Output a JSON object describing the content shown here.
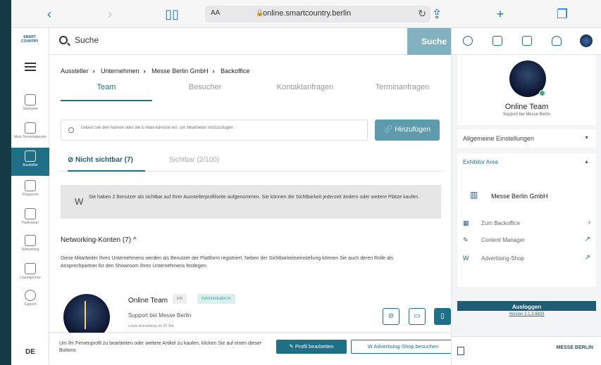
{
  "browser": {
    "text_size": "AA",
    "url": "online.smartcountry.berlin"
  },
  "nav": {
    "logo": "SMART COUNTRY",
    "items": [
      {
        "label": "Startseite"
      },
      {
        "label": "Mein Terminkalender"
      },
      {
        "label": "Aussteller"
      },
      {
        "label": "Programm"
      },
      {
        "label": "Hallenplan"
      },
      {
        "label": "Networking"
      },
      {
        "label": "Lösungsreise"
      },
      {
        "label": "Support"
      }
    ],
    "language": "DE"
  },
  "search": {
    "placeholder": "Suche",
    "button": "Suche"
  },
  "breadcrumb": [
    "Aussteller",
    "Unternehmen",
    "Messe Berlin GmbH",
    "Backoffice"
  ],
  "tabs": [
    "Team",
    "Besucher",
    "Kontaktanfragen",
    "Terminanfragen"
  ],
  "member_search": {
    "placeholder": "Geben Sie den Namen oder die E-Mail-Adresse ein, um Mitarbeiter hinzuzufügen",
    "add_button": "Hinzufügen"
  },
  "visibility_tabs": {
    "hidden": "Nicht sichtbar (7)",
    "visible": "Sichtbar (2/100)"
  },
  "info": {
    "text": "Sie haben 2 Benutzer als sichtbar auf Ihrer Ausstellerprofilseite aufgenommen. Sie können die Sichtbarkeit jederzeit ändern oder weitere Plätze kaufen."
  },
  "networking": {
    "title": "Networking-Konten (7)",
    "description": "Diese Mitarbeiter Ihres Unternehmens werden als Benutzer der Plattform registriert. Neben der Sichtbarkeitseinstellung können Sie auch deren Rolle als Ansprechpartner für den Showroom Ihres Unternehmens festlegen."
  },
  "member": {
    "name": "Online Team",
    "id_badge": "Ich",
    "role_badge": "Administrator:in",
    "role": "Support bei Messe Berlin",
    "meta": "Letzte Anmeldung vor 20 Std."
  },
  "footer": {
    "text": "Um Ihr Firmenprofil zu bearbeiten oder weitere Artikel zu kaufen, klicken Sie auf einen dieser Buttons",
    "edit_button": "Profil bearbeiten",
    "shop_button": "Advertising-Shop besuchen"
  },
  "profile": {
    "name": "Online Team",
    "subtitle": "Support bei Messe Berlin"
  },
  "panel": {
    "general_settings": "Allgemeine Einstellungen",
    "exhibitor_area": "Exhibitor Area",
    "company": "Messe Berlin GmbH",
    "links": [
      {
        "label": "Zum Backoffice",
        "icon": "grid-icon"
      },
      {
        "label": "Content Manager",
        "icon": "pencil-icon"
      },
      {
        "label": "Advertising-Shop",
        "icon": "w-icon"
      }
    ],
    "logout": "Ausloggen",
    "version": "Version 2.1.3.6833",
    "brand": "MESSE BERLIN"
  },
  "colors": {
    "primary": "#1f6f86",
    "search_button": "#82b1c0",
    "add_button": "#5e9cad",
    "online_dot": "#3cb371"
  }
}
